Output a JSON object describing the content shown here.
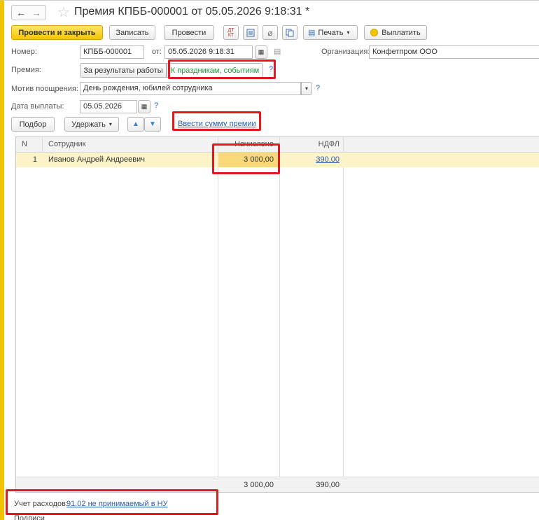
{
  "window": {
    "title": "Премия КПББ-000001 от 05.05.2026 9:18:31 *"
  },
  "toolbar": {
    "post_close": "Провести и закрыть",
    "save": "Записать",
    "post": "Провести",
    "print": "Печать",
    "pay": "Выплатить"
  },
  "form": {
    "number_label": "Номер:",
    "number_value": "КПББ-000001",
    "from_label": "от:",
    "date_value": "05.05.2026  9:18:31",
    "org_label": "Организация:",
    "org_value": "Конфетпром ООО",
    "bonus_label": "Премия:",
    "bonus_opt1": "За результаты работы",
    "bonus_opt2": "К праздникам, событиям",
    "motive_label": "Мотив поощрения:",
    "motive_value": "День рождения, юбилей сотрудника",
    "paydate_label": "Дата выплаты:",
    "paydate_value": "05.05.2026",
    "help": "?"
  },
  "table_toolbar": {
    "select": "Подбор",
    "withhold": "Удержать",
    "enter_sum": "Ввести сумму премии"
  },
  "table": {
    "headers": [
      "N",
      "Сотрудник",
      "Начислено",
      "НДФЛ"
    ],
    "rows": [
      {
        "n": "1",
        "employee": "Иванов Андрей Андреевич",
        "accrued": "3 000,00",
        "ndfl": "390,00"
      }
    ],
    "total_accrued": "3 000,00",
    "total_ndfl": "390,00"
  },
  "footer": {
    "expense_label": "Учет расходов:",
    "expense_value": "91.02 не принимаемый в НУ",
    "signatures": "Подписи"
  },
  "colors": {
    "accent": "#f6c500",
    "highlight": "#e0191e",
    "link": "#2a5db0",
    "selected_row": "#fdf3c8",
    "green_text": "#1a9a3a"
  }
}
